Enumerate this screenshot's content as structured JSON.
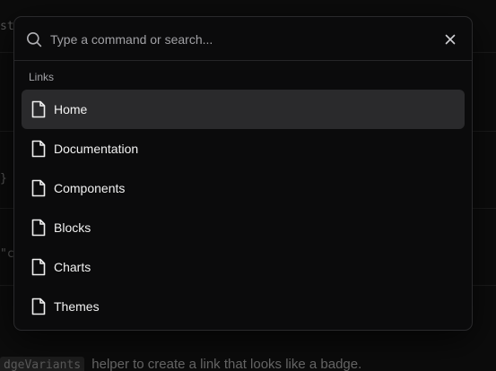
{
  "search": {
    "placeholder": "Type a command or search..."
  },
  "group": {
    "heading": "Links"
  },
  "items": [
    {
      "label": "Home",
      "active": true
    },
    {
      "label": "Documentation",
      "active": false
    },
    {
      "label": "Components",
      "active": false
    },
    {
      "label": "Blocks",
      "active": false
    },
    {
      "label": "Charts",
      "active": false
    },
    {
      "label": "Themes",
      "active": false
    }
  ],
  "background": {
    "code_fragments": [
      "st",
      "}",
      "\"c"
    ],
    "inline_code": "dgeVariants",
    "sentence": "helper to create a link that looks like a badge."
  },
  "colors": {
    "active_item": "#2a2a2c",
    "dialog_bg": "#0b0b0c",
    "border": "#2a2a2c"
  },
  "icons": {
    "search": "search-icon",
    "close": "close-icon",
    "item": "file-icon"
  }
}
